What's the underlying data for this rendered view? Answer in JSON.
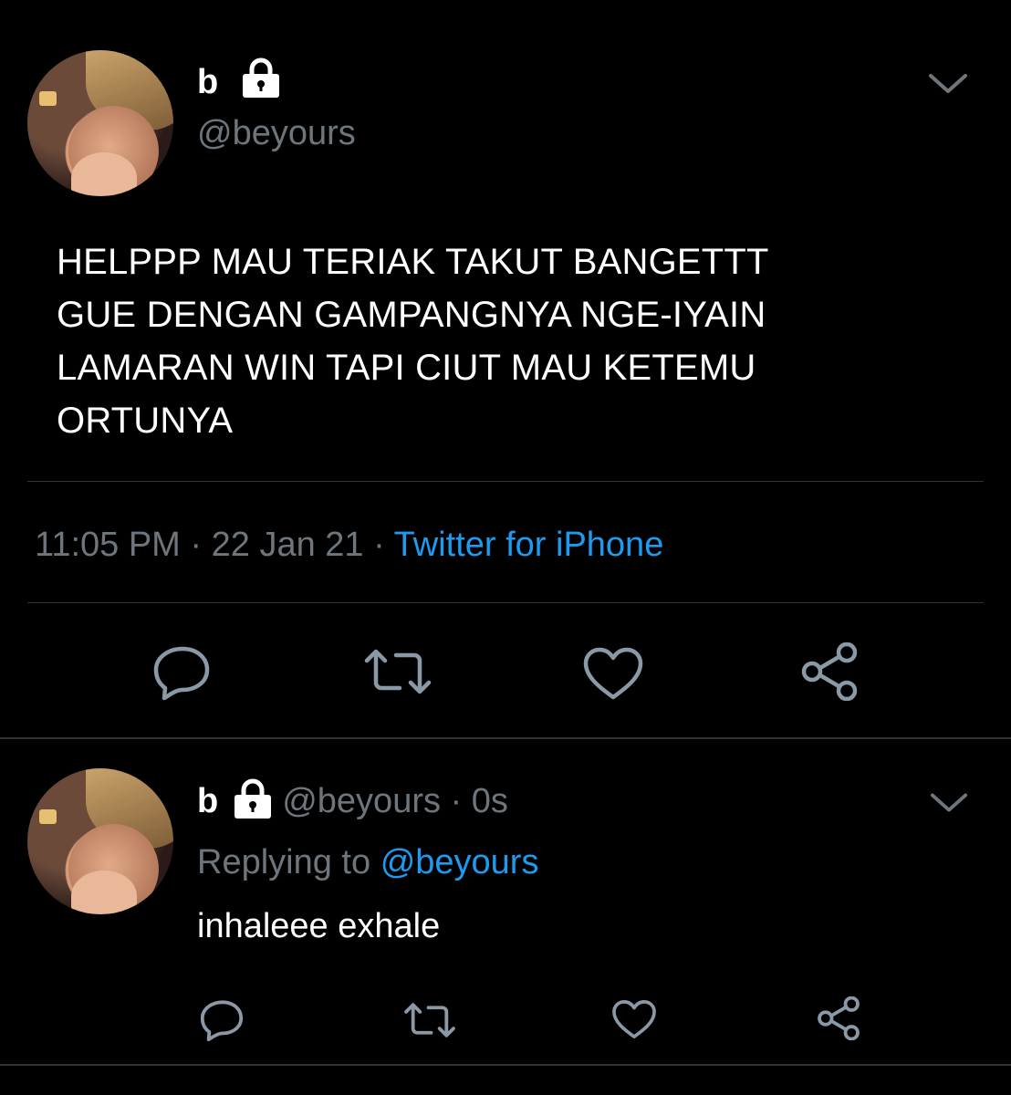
{
  "main_tweet": {
    "display_name": "b",
    "handle": "@beyours",
    "text_lines": [
      "HELPPP MAU TERIAK TAKUT BANGETTT",
      "GUE DENGAN GAMPANGNYA NGE-IYAIN",
      "LAMARAN WIN TAPI CIUT MAU KETEMU",
      "ORTUNYA"
    ],
    "time": "11:05 PM",
    "sep1": "·",
    "date": "22 Jan 21",
    "sep2": "·",
    "source": "Twitter for iPhone"
  },
  "reply_tweet": {
    "display_name": "b",
    "handle_time": "@beyours · 0s",
    "replying_label": "Replying to",
    "replying_to": "@beyours",
    "text": "inhaleee exhale"
  },
  "colors": {
    "background": "#000000",
    "text": "#ffffff",
    "secondary": "#6e767d",
    "link": "#1d9bf0",
    "divider": "#2f3336"
  }
}
